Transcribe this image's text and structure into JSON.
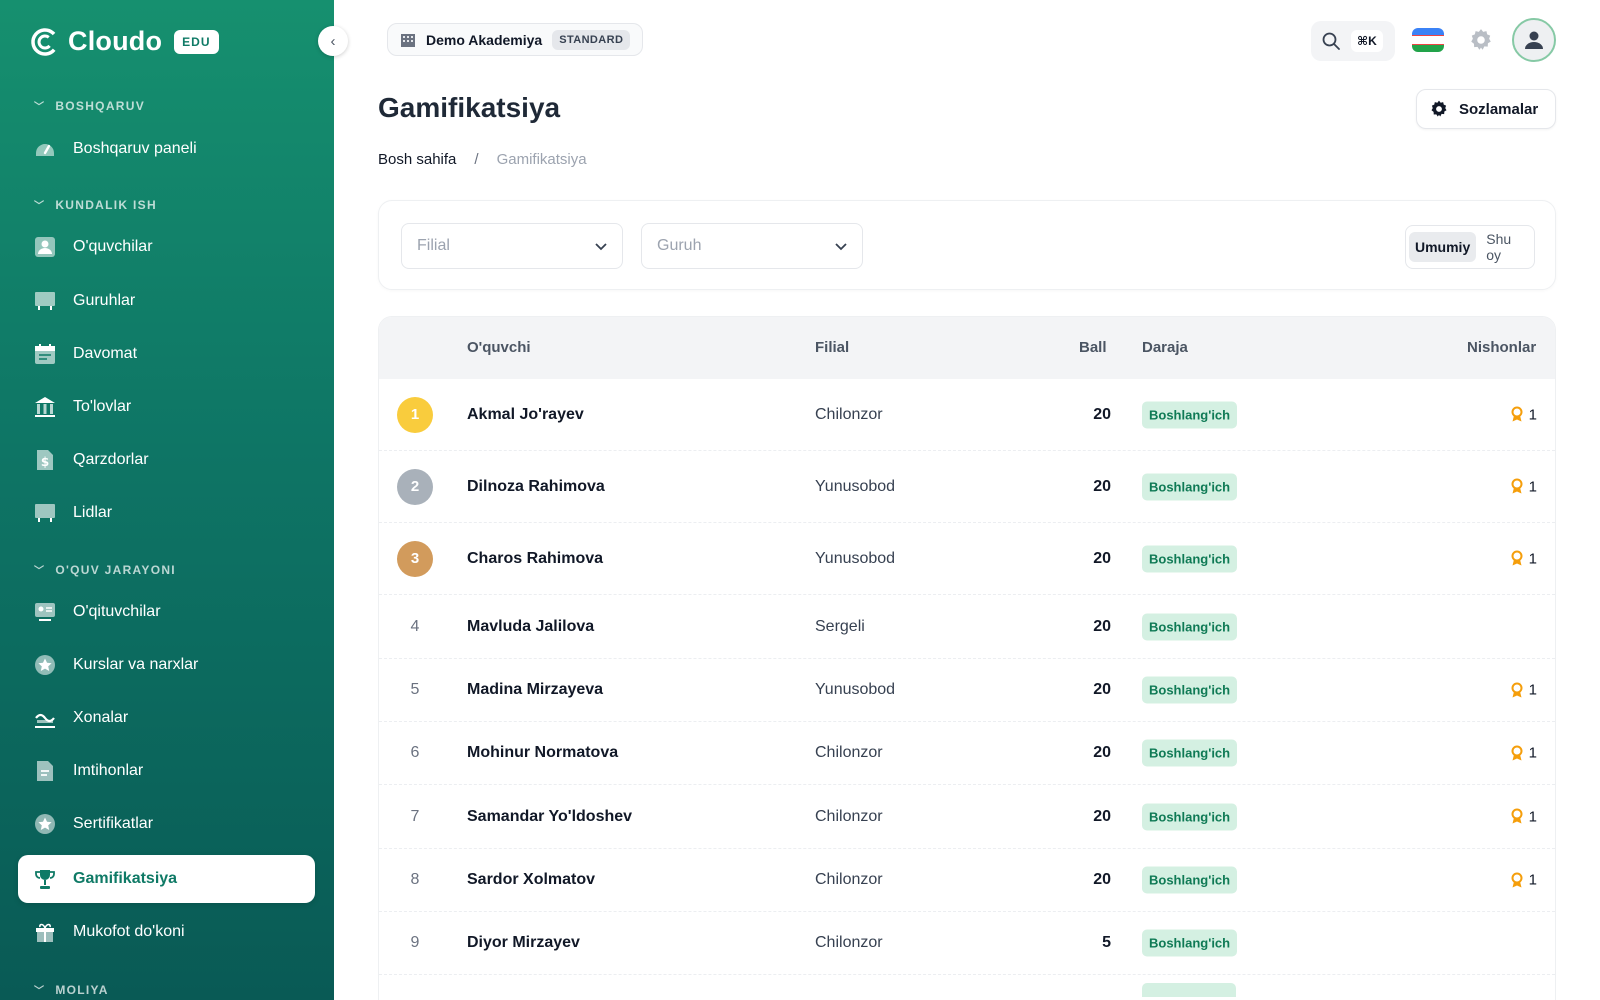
{
  "brand": {
    "name": "Cloudo",
    "badge": "EDU"
  },
  "sidebar": {
    "sections": [
      {
        "title": "BOSHQARUV"
      },
      {
        "title": "KUNDALIK ISH"
      },
      {
        "title": "O'QUV JARAYONI"
      },
      {
        "title": "MOLIYA"
      }
    ],
    "items": [
      {
        "label": "Boshqaruv paneli",
        "icon": "dashboard-icon"
      },
      {
        "label": "O'quvchilar",
        "icon": "student-icon"
      },
      {
        "label": "Guruhlar",
        "icon": "group-icon"
      },
      {
        "label": "Davomat",
        "icon": "calendar-icon"
      },
      {
        "label": "To'lovlar",
        "icon": "bank-icon"
      },
      {
        "label": "Qarzdorlar",
        "icon": "dollar-doc-icon"
      },
      {
        "label": "Lidlar",
        "icon": "board-icon"
      },
      {
        "label": "O'qituvchilar",
        "icon": "teacher-icon"
      },
      {
        "label": "Kurslar va narxlar",
        "icon": "star-icon"
      },
      {
        "label": "Xonalar",
        "icon": "room-icon"
      },
      {
        "label": "Imtihonlar",
        "icon": "exam-icon"
      },
      {
        "label": "Sertifikatlar",
        "icon": "certificate-icon"
      },
      {
        "label": "Gamifikatsiya",
        "icon": "trophy-icon",
        "active": true
      },
      {
        "label": "Mukofot do'koni",
        "icon": "gift-icon"
      }
    ]
  },
  "topbar": {
    "org_name": "Demo Akademiya",
    "org_plan": "STANDARD",
    "search_shortcut": "⌘K",
    "flag": "uzbekistan-flag"
  },
  "page": {
    "title": "Gamifikatsiya",
    "settings_label": "Sozlamalar",
    "breadcrumb": {
      "home": "Bosh sahifa",
      "sep": "/",
      "current": "Gamifikatsiya"
    }
  },
  "filters": {
    "branch_placeholder": "Filial",
    "group_placeholder": "Guruh",
    "period_options": [
      "Umumiy",
      "Shu oy"
    ],
    "period_selected": "Umumiy"
  },
  "table": {
    "headers": {
      "student": "O'quvchi",
      "branch": "Filial",
      "score": "Ball",
      "level": "Daraja",
      "badges": "Nishonlar"
    },
    "rows": [
      {
        "rank": "1",
        "name": "Akmal Jo'rayev",
        "branch": "Chilonzor",
        "score": "20",
        "level": "Boshlang'ich",
        "badges": "1"
      },
      {
        "rank": "2",
        "name": "Dilnoza Rahimova",
        "branch": "Yunusobod",
        "score": "20",
        "level": "Boshlang'ich",
        "badges": "1"
      },
      {
        "rank": "3",
        "name": "Charos Rahimova",
        "branch": "Yunusobod",
        "score": "20",
        "level": "Boshlang'ich",
        "badges": "1"
      },
      {
        "rank": "4",
        "name": "Mavluda Jalilova",
        "branch": "Sergeli",
        "score": "20",
        "level": "Boshlang'ich",
        "badges": ""
      },
      {
        "rank": "5",
        "name": "Madina Mirzayeva",
        "branch": "Yunusobod",
        "score": "20",
        "level": "Boshlang'ich",
        "badges": "1"
      },
      {
        "rank": "6",
        "name": "Mohinur Normatova",
        "branch": "Chilonzor",
        "score": "20",
        "level": "Boshlang'ich",
        "badges": "1"
      },
      {
        "rank": "7",
        "name": "Samandar Yo'ldoshev",
        "branch": "Chilonzor",
        "score": "20",
        "level": "Boshlang'ich",
        "badges": "1"
      },
      {
        "rank": "8",
        "name": "Sardor Xolmatov",
        "branch": "Chilonzor",
        "score": "20",
        "level": "Boshlang'ich",
        "badges": "1"
      },
      {
        "rank": "9",
        "name": "Diyor Mirzayev",
        "branch": "Chilonzor",
        "score": "5",
        "level": "Boshlang'ich",
        "badges": ""
      }
    ]
  },
  "colors": {
    "brand": "#0f7a66",
    "gold": "#f9cc3d",
    "silver": "#a9b1ba",
    "bronze": "#d29b5c",
    "badge_ribbon": "#f59e0b",
    "level_bg": "#d4f0e2",
    "level_text": "#0f7a55"
  }
}
